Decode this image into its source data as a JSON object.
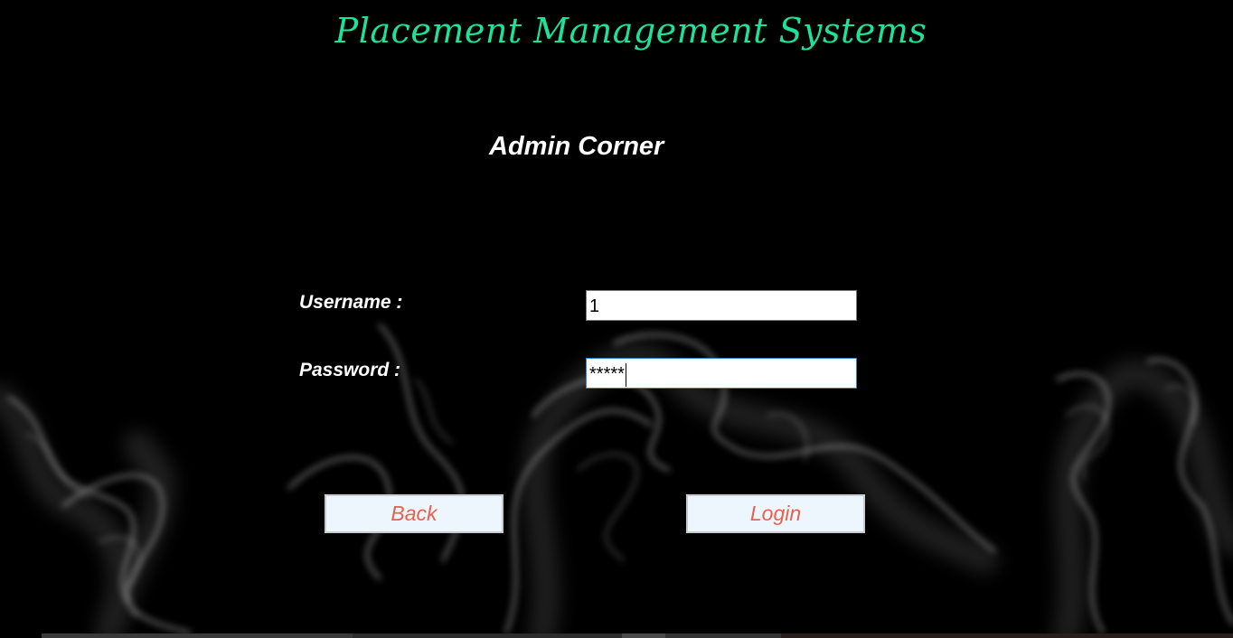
{
  "app": {
    "title": "Placement Management Systems"
  },
  "section": {
    "title": "Admin Corner"
  },
  "form": {
    "username_label": "Username :",
    "username_value": "1",
    "password_label": "Password :",
    "password_value": "*****"
  },
  "buttons": {
    "back_label": "Back",
    "login_label": "Login"
  },
  "colors": {
    "title": "#1de39a",
    "button_text": "#e5624f",
    "button_bg": "#eef6fd",
    "background": "#000000"
  },
  "icons": {
    "background": "smoke-background-image"
  }
}
